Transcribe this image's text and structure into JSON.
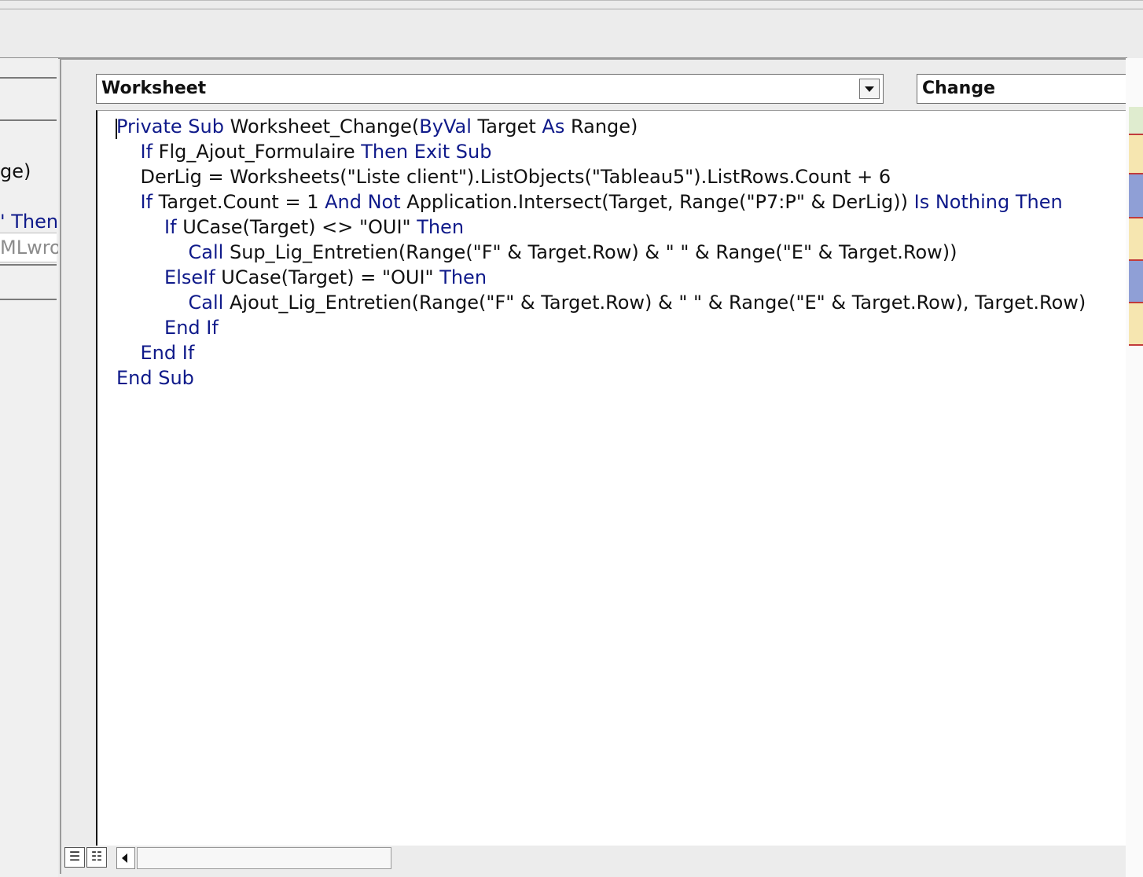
{
  "left_pane": {
    "fragments": [
      {
        "text": "ge)",
        "kind": "normal"
      },
      {
        "text": "' Then",
        "kind": "kw"
      },
      {
        "text": "MLwrol",
        "kind": "gray"
      }
    ]
  },
  "object_combo": {
    "value": "Worksheet"
  },
  "procedure_combo": {
    "value": "Change"
  },
  "code_lines": [
    [
      {
        "t": "Private Sub",
        "k": "kw"
      },
      {
        "t": " Worksheet_Change(",
        "k": ""
      },
      {
        "t": "ByVal",
        "k": "kw"
      },
      {
        "t": " Target ",
        "k": ""
      },
      {
        "t": "As",
        "k": "kw"
      },
      {
        "t": " Range)",
        "k": ""
      }
    ],
    [
      {
        "t": "    ",
        "k": ""
      },
      {
        "t": "If",
        "k": "kw"
      },
      {
        "t": " Flg_Ajout_Formulaire ",
        "k": ""
      },
      {
        "t": "Then Exit Sub",
        "k": "kw"
      }
    ],
    [
      {
        "t": "    DerLig = Worksheets(\"Liste client\").ListObjects(\"Tableau5\").ListRows.Count + 6",
        "k": ""
      }
    ],
    [
      {
        "t": "    ",
        "k": ""
      },
      {
        "t": "If",
        "k": "kw"
      },
      {
        "t": " Target.Count = 1 ",
        "k": ""
      },
      {
        "t": "And Not",
        "k": "kw"
      },
      {
        "t": " Application.Intersect(Target, Range(\"P7:P\" & DerLig)) ",
        "k": ""
      },
      {
        "t": "Is Nothing Then",
        "k": "kw"
      }
    ],
    [
      {
        "t": "        ",
        "k": ""
      },
      {
        "t": "If",
        "k": "kw"
      },
      {
        "t": " UCase(Target) <> \"OUI\" ",
        "k": ""
      },
      {
        "t": "Then",
        "k": "kw"
      }
    ],
    [
      {
        "t": "            ",
        "k": ""
      },
      {
        "t": "Call",
        "k": "kw"
      },
      {
        "t": " Sup_Lig_Entretien(Range(\"F\" & Target.Row) & \" \" & Range(\"E\" & Target.Row))",
        "k": ""
      }
    ],
    [
      {
        "t": "        ",
        "k": ""
      },
      {
        "t": "ElseIf",
        "k": "kw"
      },
      {
        "t": " UCase(Target) = \"OUI\" ",
        "k": ""
      },
      {
        "t": "Then",
        "k": "kw"
      }
    ],
    [
      {
        "t": "            ",
        "k": ""
      },
      {
        "t": "Call",
        "k": "kw"
      },
      {
        "t": " Ajout_Lig_Entretien(Range(\"F\" & Target.Row) & \" \" & Range(\"E\" & Target.Row), Target.Row)",
        "k": ""
      }
    ],
    [
      {
        "t": "        ",
        "k": ""
      },
      {
        "t": "End If",
        "k": "kw"
      }
    ],
    [
      {
        "t": "    ",
        "k": ""
      },
      {
        "t": "End If",
        "k": "kw"
      }
    ],
    [
      {
        "t": "End Sub",
        "k": "kw"
      }
    ]
  ],
  "colors": {
    "keyword": "#0f1a8a",
    "text": "#111111",
    "sheet_cell_yellow": "#f6e6b0",
    "sheet_cell_blue": "#8f9fd6",
    "sheet_cell_green": "#dfeccf"
  },
  "icons": {
    "object_dropdown": "chevron-down-icon",
    "procedure_view": "procedure-view-icon",
    "full_module_view": "full-module-view-icon",
    "scroll_left": "arrow-left-icon"
  }
}
